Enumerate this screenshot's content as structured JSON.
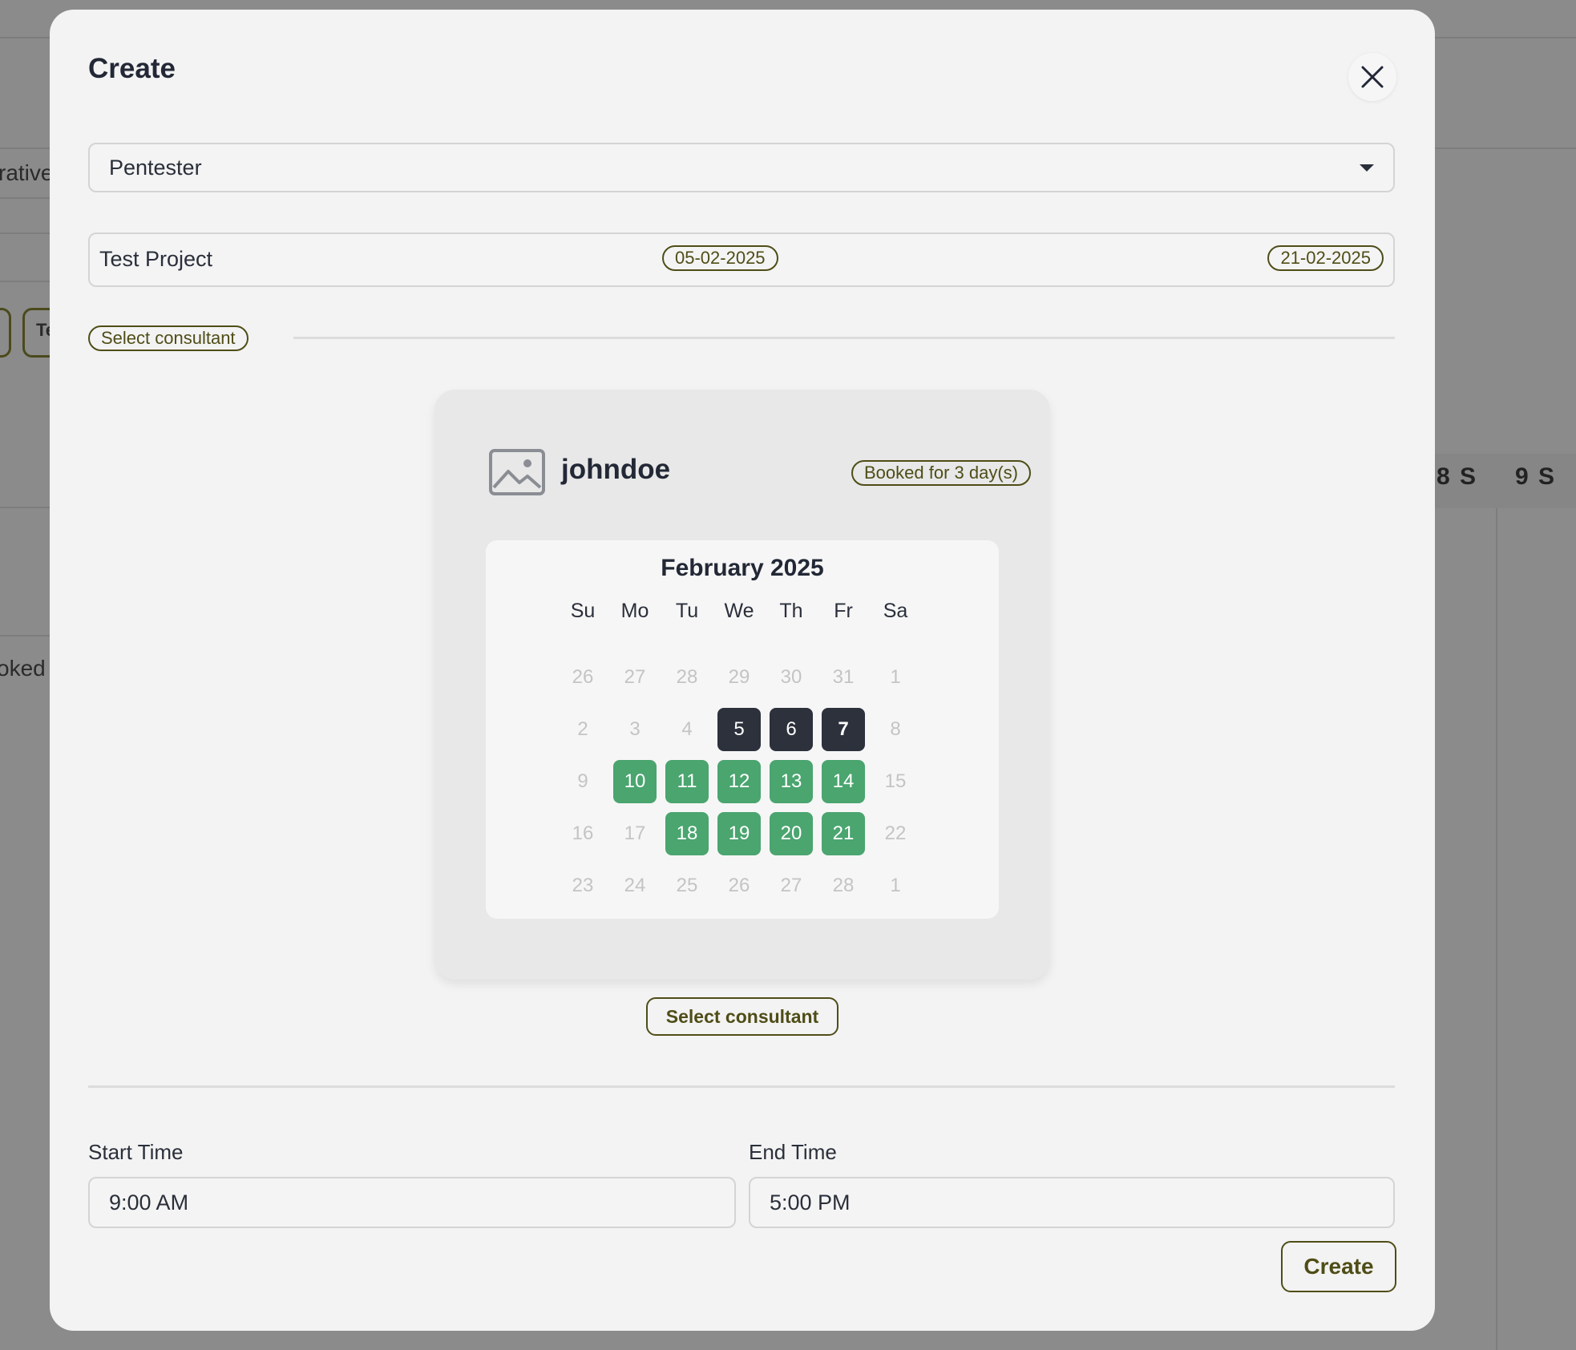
{
  "background": {
    "fragments": [
      "rative",
      "oked",
      "Te"
    ],
    "day_headers": [
      "8 S",
      "9 S"
    ]
  },
  "modal": {
    "title": "Create",
    "role_select": {
      "value": "Pentester"
    },
    "project": {
      "name": "Test Project",
      "start_date": "05-02-2025",
      "end_date": "21-02-2025"
    },
    "section_label": "Select consultant",
    "consultant": {
      "username": "johndoe",
      "booked_badge": "Booked for 3 day(s)",
      "calendar": {
        "month_label": "February 2025",
        "weekdays": [
          "Su",
          "Mo",
          "Tu",
          "We",
          "Th",
          "Fr",
          "Sa"
        ],
        "weeks": [
          [
            "26",
            "27",
            "28",
            "29",
            "30",
            "31",
            "1"
          ],
          [
            "2",
            "3",
            "4",
            "5",
            "6",
            "7",
            "8"
          ],
          [
            "9",
            "10",
            "11",
            "12",
            "13",
            "14",
            "15"
          ],
          [
            "16",
            "17",
            "18",
            "19",
            "20",
            "21",
            "22"
          ],
          [
            "23",
            "24",
            "25",
            "26",
            "27",
            "28",
            "1"
          ]
        ],
        "booked_days": [
          "5",
          "6",
          "7"
        ],
        "available_days": [
          "10",
          "11",
          "12",
          "13",
          "14",
          "18",
          "19",
          "20",
          "21"
        ]
      }
    },
    "select_consultant_button": "Select consultant",
    "start_time": {
      "label": "Start Time",
      "value": "9:00 AM"
    },
    "end_time": {
      "label": "End Time",
      "value": "5:00 PM"
    },
    "create_button": "Create"
  },
  "colors": {
    "booked": "#2c313c",
    "available": "#4aa56f",
    "accent": "#4f4d17"
  }
}
